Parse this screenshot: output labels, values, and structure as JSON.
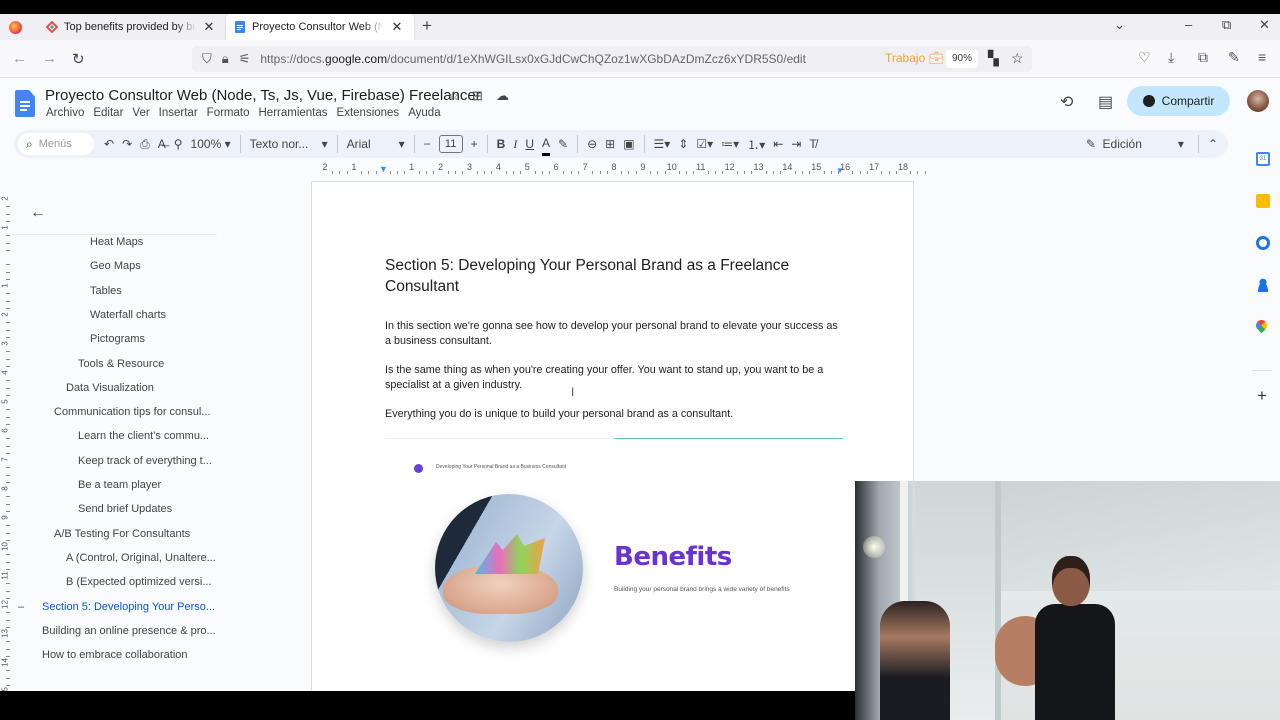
{
  "browser": {
    "tabs": [
      {
        "title": "Top benefits provided by building",
        "active": false,
        "favicon": "gamma-icon"
      },
      {
        "title": "Proyecto Consultor Web (Node, Ts, Js",
        "active": true,
        "favicon": "docs-icon"
      }
    ],
    "new_tab": "+",
    "url_prefix": "https://docs.",
    "url_domain": "google.com",
    "url_path": "/document/d/1eXhWGILsx0xGJdCwChQZoz1wXGbDAzDmZcz6xYDR5S0/edit",
    "container_label": "Trabajo",
    "zoom_level": "90%",
    "window_controls": {
      "list": "⌄",
      "minimize": "–",
      "restore": "⧉",
      "close": "✕"
    }
  },
  "docs": {
    "title": "Proyecto Consultor Web (Node, Ts, Js, Vue, Firebase) Freelancer",
    "menu": [
      "Archivo",
      "Editar",
      "Ver",
      "Insertar",
      "Formato",
      "Herramientas",
      "Extensiones",
      "Ayuda"
    ],
    "share_label": "Compartir",
    "toolbar": {
      "search_placeholder": "Menús",
      "zoom": "100%",
      "style": "Texto nor...",
      "font": "Arial",
      "font_size": "11",
      "bold": "B",
      "italic": "I",
      "underline": "U",
      "text_color": "A",
      "mode": "Edición"
    },
    "ruler_h": [
      "2",
      "1",
      "",
      "1",
      "2",
      "3",
      "4",
      "5",
      "6",
      "7",
      "8",
      "9",
      "10",
      "11",
      "12",
      "13",
      "14",
      "15",
      "16",
      "17",
      "18"
    ],
    "ruler_v": [
      "2",
      "1",
      "",
      "1",
      "2",
      "3",
      "4",
      "5",
      "6",
      "7",
      "8",
      "9",
      "10",
      "11",
      "12",
      "13",
      "14",
      "15"
    ]
  },
  "outline": {
    "items": [
      {
        "label": "Heat Maps",
        "level": 4
      },
      {
        "label": "Geo Maps",
        "level": 4
      },
      {
        "label": "Tables",
        "level": 4
      },
      {
        "label": "Waterfall charts",
        "level": 4
      },
      {
        "label": "Pictograms",
        "level": 4
      },
      {
        "label": "Tools & Resource",
        "level": 3
      },
      {
        "label": "Data Visualization",
        "level": 2
      },
      {
        "label": "Communication tips for consul...",
        "level": 1
      },
      {
        "label": "Learn the client's commu...",
        "level": 3
      },
      {
        "label": "Keep track of everything t...",
        "level": 3
      },
      {
        "label": "Be a team player",
        "level": 3
      },
      {
        "label": "Send brief Updates",
        "level": 3
      },
      {
        "label": "A/B Testing For Consultants",
        "level": 1
      },
      {
        "label": "A (Control, Original, Unaltere...",
        "level": 2
      },
      {
        "label": "B (Expected optimized versi...",
        "level": 2
      },
      {
        "label": "Section 5: Developing Your Perso...",
        "level": 0,
        "active": true
      },
      {
        "label": "Building an online presence & pro...",
        "level": 0
      },
      {
        "label": "How to embrace collaboration",
        "level": 0
      }
    ],
    "active_marker": "–"
  },
  "page": {
    "heading": "Section 5: Developing Your Personal Brand as a Freelance Consultant",
    "paragraphs": [
      "In this section we're gonna see how to develop your personal brand to elevate your success as a business consultant.",
      "Is the same thing as when you're creating your offer. You want to stand up, you want to be a specialist at a given industry.",
      "Everything you do is unique to build your personal brand as a consultant."
    ],
    "slide": {
      "header": "Developing Your Personal Brand as a Business Consultant",
      "title": "Benefits",
      "subtitle": "Building your personal brand brings a wide variety of benefits",
      "accent": "#6a33cf"
    }
  },
  "side_panel": [
    "calendar-icon",
    "keep-icon",
    "tasks-icon",
    "contacts-icon",
    "maps-icon"
  ],
  "side_panel_add": "+",
  "colors": {
    "share_bg": "#c2e7ff",
    "active_outline": "#0b57d0",
    "docs_blue": "#4285f4"
  }
}
